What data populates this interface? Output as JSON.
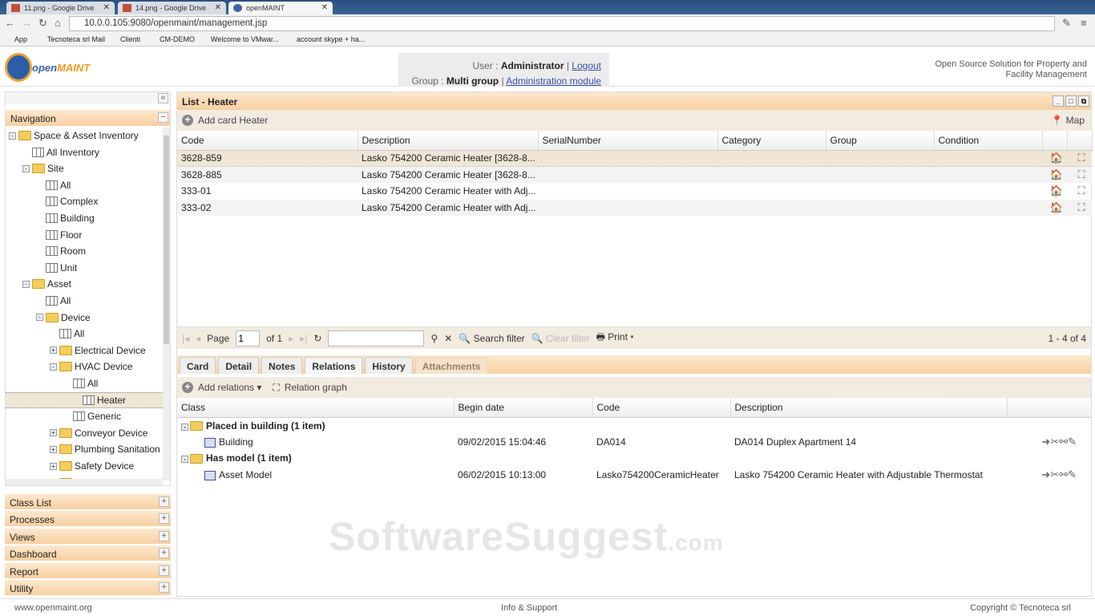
{
  "browser": {
    "tabs": [
      "11.png - Google Drive",
      "14.png - Google Drive",
      "openMAINT"
    ],
    "url": "10.0.0.105:9080/openmaint/management.jsp",
    "bookmarks": [
      "App",
      "Tecnoteca srl Mail",
      "Clienti",
      "CM-DEMO",
      "Welcome to VMwar...",
      "account skype + ha..."
    ]
  },
  "header": {
    "logo": "openMAINT",
    "user_label": "User :",
    "user": "Administrator",
    "logout": "Logout",
    "group_label": "Group :",
    "group": "Multi group",
    "admin": "Administration module",
    "tagline": "Open Source Solution for Property and Facility Management"
  },
  "nav": {
    "title": "Navigation",
    "tree": [
      {
        "label": "Space & Asset Inventory",
        "level": 0,
        "type": "folder",
        "tog": "-"
      },
      {
        "label": "All Inventory",
        "level": 1,
        "type": "all"
      },
      {
        "label": "Site",
        "level": 1,
        "type": "folder",
        "tog": "-"
      },
      {
        "label": "All",
        "level": 2,
        "type": "all"
      },
      {
        "label": "Complex",
        "level": 2,
        "type": "grid"
      },
      {
        "label": "Building",
        "level": 2,
        "type": "grid"
      },
      {
        "label": "Floor",
        "level": 2,
        "type": "grid"
      },
      {
        "label": "Room",
        "level": 2,
        "type": "grid"
      },
      {
        "label": "Unit",
        "level": 2,
        "type": "grid"
      },
      {
        "label": "Asset",
        "level": 1,
        "type": "folder",
        "tog": "-"
      },
      {
        "label": "All",
        "level": 2,
        "type": "all"
      },
      {
        "label": "Device",
        "level": 2,
        "type": "folder",
        "tog": "-"
      },
      {
        "label": "All",
        "level": 3,
        "type": "all"
      },
      {
        "label": "Electrical Device",
        "level": 3,
        "type": "folder",
        "tog": "+"
      },
      {
        "label": "HVAC Device",
        "level": 3,
        "type": "folder",
        "tog": "-"
      },
      {
        "label": "All",
        "level": 4,
        "type": "all"
      },
      {
        "label": "Heater",
        "level": 4,
        "type": "grid",
        "selected": true
      },
      {
        "label": "Generic",
        "level": 4,
        "type": "grid"
      },
      {
        "label": "Conveyor Device",
        "level": 3,
        "type": "folder",
        "tog": "+"
      },
      {
        "label": "Plumbing Sanitation",
        "level": 3,
        "type": "folder",
        "tog": "+"
      },
      {
        "label": "Safety Device",
        "level": 3,
        "type": "folder",
        "tog": "+"
      },
      {
        "label": "IT Device",
        "level": 3,
        "type": "folder",
        "tog": "+"
      }
    ],
    "sections": [
      "Class List",
      "Processes",
      "Views",
      "Dashboard",
      "Report",
      "Utility"
    ]
  },
  "list": {
    "title": "List - Heater",
    "add": "Add card Heater",
    "map": "Map",
    "columns": [
      "Code",
      "Description",
      "SerialNumber",
      "Category",
      "Group",
      "Condition"
    ],
    "rows": [
      [
        "3628-859",
        "Lasko 754200 Ceramic Heater [3628-8..."
      ],
      [
        "3628-885",
        "Lasko 754200 Ceramic Heater [3628-8..."
      ],
      [
        "333-01",
        "Lasko 754200 Ceramic Heater with Adj..."
      ],
      [
        "333-02",
        "Lasko 754200 Ceramic Heater with Adj..."
      ]
    ]
  },
  "pager": {
    "page_label": "Page",
    "page": "1",
    "of": "of 1",
    "search_filter": "Search filter",
    "clear_filter": "Clear filter",
    "print": "Print",
    "count": "1 - 4 of 4"
  },
  "tabs": [
    "Card",
    "Detail",
    "Notes",
    "Relations",
    "History",
    "Attachments"
  ],
  "relations": {
    "add": "Add relations",
    "graph": "Relation graph",
    "columns": [
      "Class",
      "Begin date",
      "Code",
      "Description"
    ],
    "groups": [
      {
        "title": "Placed in building (1 item)",
        "item": {
          "class": "Building",
          "date": "09/02/2015 15:04:46",
          "code": "DA014",
          "desc": "DA014 Duplex Apartment 14"
        }
      },
      {
        "title": "Has model (1 item)",
        "item": {
          "class": "Asset Model",
          "date": "06/02/2015 10:13:00",
          "code": "Lasko754200CeramicHeater",
          "desc": "Lasko 754200 Ceramic Heater with Adjustable Thermostat"
        }
      }
    ]
  },
  "footer": {
    "left": "www.openmaint.org",
    "center": "Info & Support",
    "right": "Copyright © Tecnoteca srl"
  },
  "watermark": "SoftwareSuggest.com"
}
